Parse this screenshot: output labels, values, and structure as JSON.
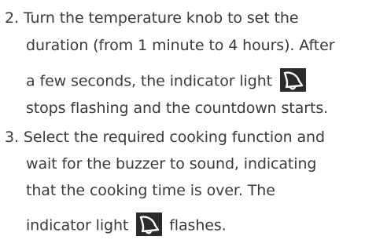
{
  "steps": [
    {
      "number": "2.",
      "lines": [
        "Turn the temperature knob to set the",
        "duration (from 1 minute to 4 hours). After",
        "a few seconds, the indicator light",
        "stops flashing and the countdown starts."
      ],
      "icon_after_line": 2,
      "icon": "bell-icon"
    },
    {
      "number": "3.",
      "lines": [
        "Select the required cooking function and",
        "wait for the buzzer to sound, indicating",
        "that the cooking time is over. The",
        "indicator light",
        "flashes."
      ],
      "icon_after_line": 3,
      "icon": "bell-icon"
    }
  ],
  "colors": {
    "text": "#3a3a3a",
    "icon_bg": "#2b2b2b",
    "icon_fg": "#ffffff"
  }
}
